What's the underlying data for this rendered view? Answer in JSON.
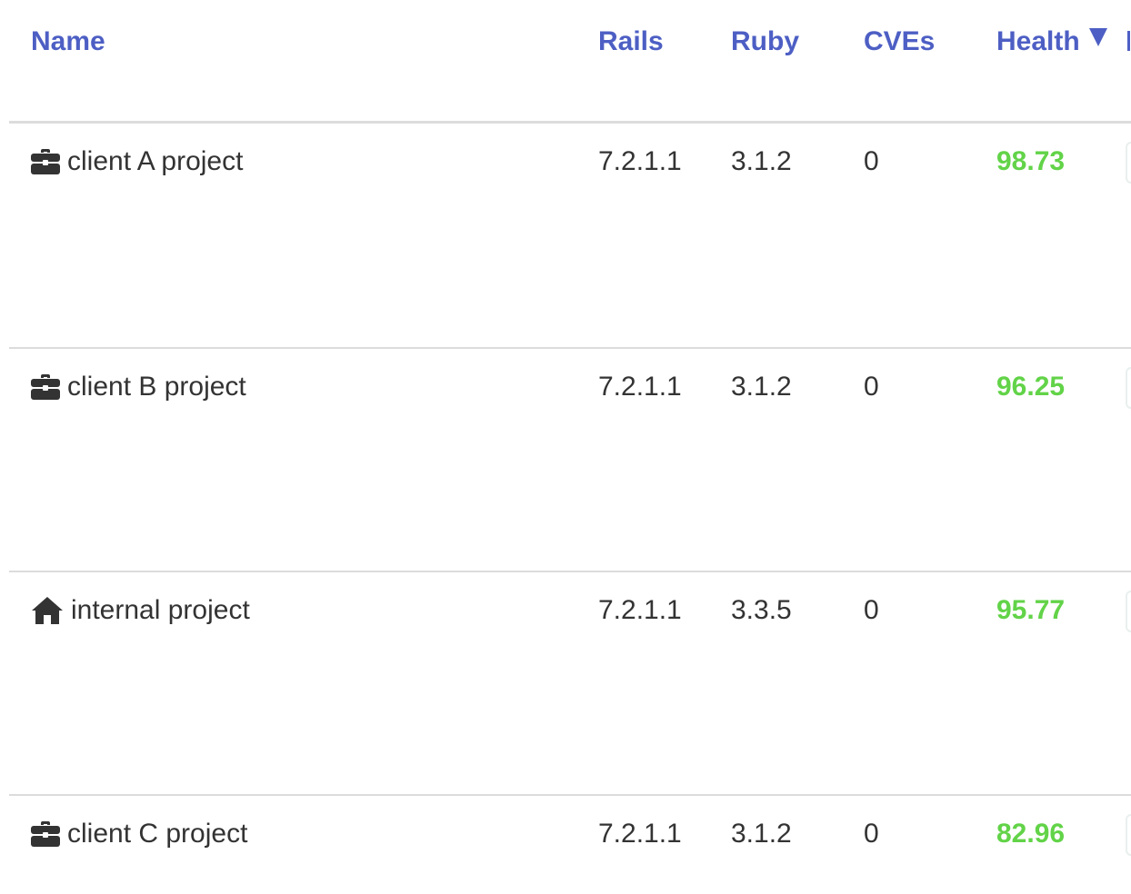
{
  "columns": {
    "name": "Name",
    "rails": "Rails",
    "ruby": "Ruby",
    "cves": "CVEs",
    "health": "Health"
  },
  "sort": {
    "column": "health",
    "direction": "descending"
  },
  "rows": [
    {
      "icon": "briefcase-icon",
      "name": "client A project",
      "rails": "7.2.1.1",
      "ruby": "3.1.2",
      "cves": "0",
      "health": "98.73"
    },
    {
      "icon": "briefcase-icon",
      "name": "client B project",
      "rails": "7.2.1.1",
      "ruby": "3.1.2",
      "cves": "0",
      "health": "96.25"
    },
    {
      "icon": "home-icon",
      "name": "internal project",
      "rails": "7.2.1.1",
      "ruby": "3.3.5",
      "cves": "0",
      "health": "95.77"
    },
    {
      "icon": "briefcase-icon",
      "name": "client C project",
      "rails": "7.2.1.1",
      "ruby": "3.1.2",
      "cves": "0",
      "health": "82.96"
    }
  ],
  "colors": {
    "header_link": "#4d5fc4",
    "health_good": "#62d348",
    "text": "#333333",
    "divider": "#dcdcdc"
  }
}
